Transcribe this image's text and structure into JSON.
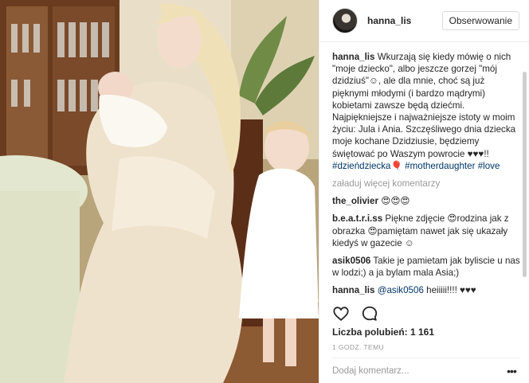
{
  "post": {
    "username": "hanna_lis",
    "follow_label": "Obserwowanie",
    "caption": {
      "user": "hanna_lis",
      "text": "Wkurzają się kiedy mówię o nich \"moje dziecko\", albo jeszcze gorzej \"mój dzidziuś\"☺, ale dla mnie, choć są już pięknymi młodymi (i bardzo mądrymi) kobietami zawsze będą dziećmi. Najpiękniejsze i najważniejsze istoty w moim życiu: Jula i Ania. Szczęśliwego dnia dziecka moje kochane Dzidziusie, będziemy świętować po Waszym powrocie ♥♥♥!! ",
      "tags": [
        "#dzieńdziecka🎈",
        "#motherdaughter",
        "#love"
      ]
    },
    "load_more_label": "załaduj więcej komentarzy",
    "comments": [
      {
        "user": "the_olivier",
        "text": "😍😍😍"
      },
      {
        "user": "b.e.a.t.r.i.ss",
        "text": "Piękne zdjęcie 😍rodzina jak z obrazka 😍pamiętam nawet jak się ukazały kiedyś w gazecie ☺"
      },
      {
        "user": "asik0506",
        "text": "Takie je pamietam jak byliscie u nas w lodzi;) a ja bylam mala Asia;)"
      },
      {
        "user": "hanna_lis",
        "mention": "@asik0506",
        "text": " heiiiii!!!! ♥♥♥"
      }
    ],
    "actions": {
      "like_icon": "heart-icon",
      "comment_icon": "comment-bubble-icon"
    },
    "likes_label": "Liczba polubień: 1 161",
    "time_label": "1 GODZ. TEMU",
    "add_comment_placeholder": "Dodaj komentarz...",
    "more_label": "•••"
  }
}
